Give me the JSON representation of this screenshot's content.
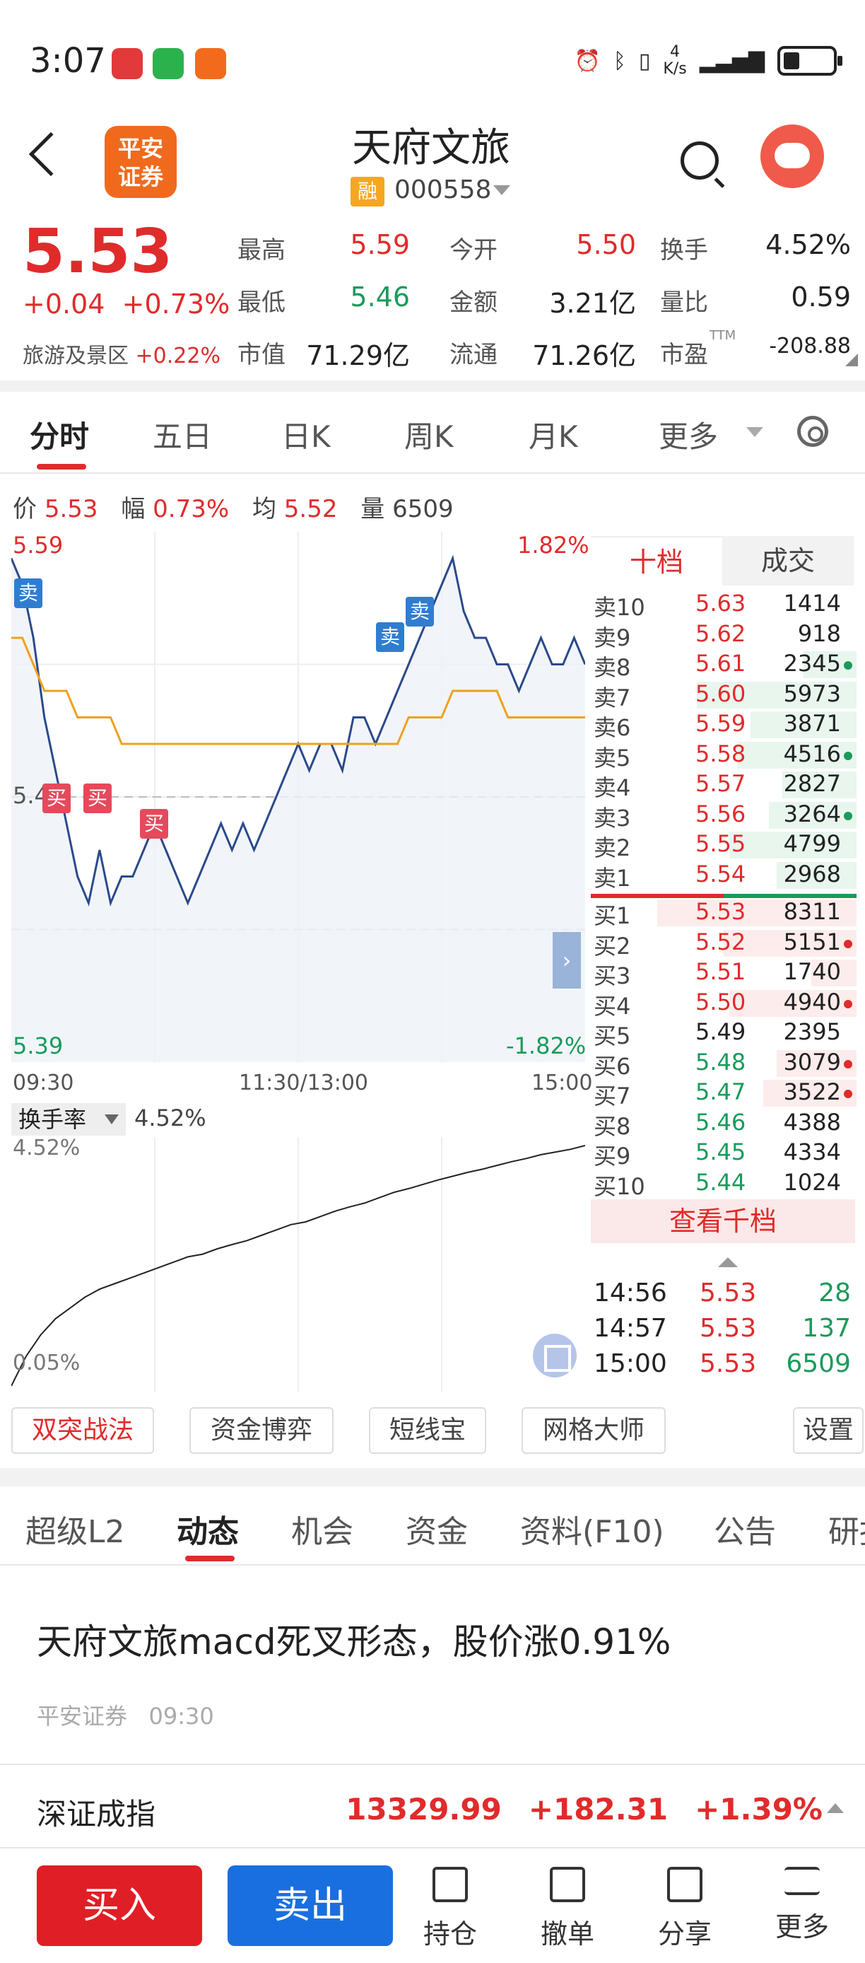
{
  "status_bar": {
    "time": "3:07",
    "speed_top": "4",
    "speed_unit": "K/s"
  },
  "header": {
    "title": "天府文旅",
    "rong": "融",
    "code": "000558",
    "broker_logo": "平安\n证券"
  },
  "quote": {
    "price": "5.53",
    "change": "+0.04",
    "change_pct": "+0.73%",
    "sector_label": "旅游及景区",
    "sector_pct": "+0.22%",
    "rows": [
      {
        "l1": "最高",
        "v1": "5.59",
        "c1": "red",
        "l2": "今开",
        "v2": "5.50",
        "c2": "red",
        "l3": "换手",
        "v3": "4.52%",
        "c3": "blk"
      },
      {
        "l1": "最低",
        "v1": "5.46",
        "c1": "green",
        "l2": "金额",
        "v2": "3.21亿",
        "c2": "blk",
        "l3": "量比",
        "v3": "0.59",
        "c3": "blk"
      },
      {
        "l1": "市值",
        "v1": "71.29亿",
        "c1": "blk",
        "l2": "流通",
        "v2": "71.26亿",
        "c2": "blk",
        "l3": "市盈",
        "v3": "-208.88",
        "c3": "blk",
        "sup": "TTM"
      }
    ]
  },
  "period_tabs": [
    "分时",
    "五日",
    "日K",
    "周K",
    "月K",
    "更多"
  ],
  "infobar": {
    "price_label": "价",
    "price": "5.53",
    "amp_label": "幅",
    "amp": "0.73%",
    "avg_label": "均",
    "avg": "5.52",
    "vol_label": "量",
    "vol": "6509"
  },
  "chart_labels": {
    "top_left": "5.59",
    "top_right": "1.82%",
    "mid_left": "5.4",
    "bottom_left": "5.39",
    "bottom_right": "-1.82%",
    "t_start": "09:30",
    "t_mid": "11:30/13:00",
    "t_end": "15:00",
    "sell_tag": "卖",
    "buy_tag": "买"
  },
  "turnover": {
    "selector": "换手率",
    "value": "4.52%",
    "top": "4.52%",
    "bottom": "0.05%"
  },
  "chart_data": [
    {
      "type": "line",
      "title": "",
      "ylim": [
        5.39,
        5.59
      ],
      "series": [
        {
          "values": [
            5.58,
            5.57,
            5.55,
            5.52,
            5.5,
            5.48,
            5.46,
            5.45,
            5.47,
            5.45,
            5.46,
            5.46,
            5.47,
            5.48,
            5.47,
            5.46,
            5.45,
            5.46,
            5.47,
            5.48,
            5.47,
            5.48,
            5.47,
            5.48,
            5.49,
            5.5,
            5.51,
            5.5,
            5.51,
            5.51,
            5.5,
            5.52,
            5.52,
            5.51,
            5.52,
            5.53,
            5.54,
            5.55,
            5.56,
            5.57,
            5.58,
            5.56,
            5.55,
            5.55,
            5.54,
            5.54,
            5.53,
            5.54,
            5.55,
            5.54,
            5.54,
            5.55,
            5.54
          ]
        },
        {
          "values": [
            5.55,
            5.55,
            5.54,
            5.53,
            5.53,
            5.53,
            5.52,
            5.52,
            5.52,
            5.52,
            5.51,
            5.51,
            5.51,
            5.51,
            5.51,
            5.51,
            5.51,
            5.51,
            5.51,
            5.51,
            5.51,
            5.51,
            5.51,
            5.51,
            5.51,
            5.51,
            5.51,
            5.51,
            5.51,
            5.51,
            5.51,
            5.51,
            5.51,
            5.51,
            5.51,
            5.51,
            5.52,
            5.52,
            5.52,
            5.52,
            5.53,
            5.53,
            5.53,
            5.53,
            5.53,
            5.52,
            5.52,
            5.52,
            5.52,
            5.52,
            5.52,
            5.52,
            5.52
          ]
        }
      ]
    },
    {
      "type": "line",
      "title": "",
      "ylim": [
        0.05,
        4.52
      ],
      "series": [
        {
          "values": [
            0.05,
            0.6,
            1.0,
            1.3,
            1.5,
            1.7,
            1.85,
            1.95,
            2.05,
            2.15,
            2.25,
            2.35,
            2.45,
            2.5,
            2.6,
            2.68,
            2.75,
            2.85,
            2.95,
            3.05,
            3.1,
            3.2,
            3.3,
            3.38,
            3.45,
            3.55,
            3.65,
            3.72,
            3.8,
            3.88,
            3.95,
            4.02,
            4.08,
            4.15,
            4.22,
            4.28,
            4.35,
            4.4,
            4.45,
            4.52
          ]
        }
      ]
    }
  ],
  "orderbook": {
    "tab_active": "十档",
    "tab_other": "成交",
    "asks": [
      {
        "label": "卖10",
        "price": "5.63",
        "pc": "red",
        "vol": "1414",
        "bar": 0.0,
        "dot": ""
      },
      {
        "label": "卖9",
        "price": "5.62",
        "pc": "red",
        "vol": "918",
        "bar": 0.0,
        "dot": ""
      },
      {
        "label": "卖8",
        "price": "5.61",
        "pc": "red",
        "vol": "2345",
        "bar": 0.2,
        "dot": "green"
      },
      {
        "label": "卖7",
        "price": "5.60",
        "pc": "red",
        "vol": "5973",
        "bar": 0.6,
        "dot": ""
      },
      {
        "label": "卖6",
        "price": "5.59",
        "pc": "red",
        "vol": "3871",
        "bar": 0.4,
        "dot": ""
      },
      {
        "label": "卖5",
        "price": "5.58",
        "pc": "red",
        "vol": "4516",
        "bar": 0.45,
        "dot": "green"
      },
      {
        "label": "卖4",
        "price": "5.57",
        "pc": "red",
        "vol": "2827",
        "bar": 0.28,
        "dot": ""
      },
      {
        "label": "卖3",
        "price": "5.56",
        "pc": "red",
        "vol": "3264",
        "bar": 0.33,
        "dot": "green"
      },
      {
        "label": "卖2",
        "price": "5.55",
        "pc": "red",
        "vol": "4799",
        "bar": 0.48,
        "dot": ""
      },
      {
        "label": "卖1",
        "price": "5.54",
        "pc": "red",
        "vol": "2968",
        "bar": 0.3,
        "dot": ""
      }
    ],
    "bids": [
      {
        "label": "买1",
        "price": "5.53",
        "pc": "red",
        "vol": "8311",
        "bar": 0.75,
        "dot": ""
      },
      {
        "label": "买2",
        "price": "5.52",
        "pc": "red",
        "vol": "5151",
        "bar": 0.5,
        "dot": "red"
      },
      {
        "label": "买3",
        "price": "5.51",
        "pc": "red",
        "vol": "1740",
        "bar": 0.17,
        "dot": ""
      },
      {
        "label": "买4",
        "price": "5.50",
        "pc": "red",
        "vol": "4940",
        "bar": 0.48,
        "dot": "red"
      },
      {
        "label": "买5",
        "price": "5.49",
        "pc": "blk",
        "vol": "2395",
        "bar": 0.0,
        "dot": ""
      },
      {
        "label": "买6",
        "price": "5.48",
        "pc": "green",
        "vol": "3079",
        "bar": 0.3,
        "dot": "red"
      },
      {
        "label": "买7",
        "price": "5.47",
        "pc": "green",
        "vol": "3522",
        "bar": 0.35,
        "dot": "red"
      },
      {
        "label": "买8",
        "price": "5.46",
        "pc": "green",
        "vol": "4388",
        "bar": 0.0,
        "dot": ""
      },
      {
        "label": "买9",
        "price": "5.45",
        "pc": "green",
        "vol": "4334",
        "bar": 0.0,
        "dot": ""
      },
      {
        "label": "买10",
        "price": "5.44",
        "pc": "green",
        "vol": "1024",
        "bar": 0.0,
        "dot": ""
      }
    ],
    "view_more": "查看千档",
    "trades": [
      {
        "time": "14:56",
        "price": "5.53",
        "vol": "28"
      },
      {
        "time": "14:57",
        "price": "5.53",
        "vol": "137"
      },
      {
        "time": "15:00",
        "price": "5.53",
        "vol": "6509"
      }
    ]
  },
  "tools": [
    "双突战法",
    "资金博弈",
    "短线宝",
    "网格大师",
    "设置"
  ],
  "info_tabs": [
    "超级L2",
    "动态",
    "机会",
    "资金",
    "资料(F10)",
    "公告",
    "研报"
  ],
  "news": {
    "title": "天府文旅macd死叉形态，股价涨0.91%",
    "source": "平安证券",
    "time": "09:30"
  },
  "index": {
    "name": "深证成指",
    "value": "13329.99",
    "change": "+182.31",
    "pct": "+1.39%"
  },
  "bottom": {
    "buy": "买入",
    "sell": "卖出",
    "b1": "持仓",
    "b2": "撤单",
    "b3": "分享",
    "b4": "更多"
  },
  "colors": {
    "up": "#e02b2b",
    "down": "#1a9b5a",
    "price_line": "#2b4a8a",
    "avg_line": "#f0a020",
    "buy_btn": "#e01e26",
    "sell_btn": "#1a6fe0"
  }
}
